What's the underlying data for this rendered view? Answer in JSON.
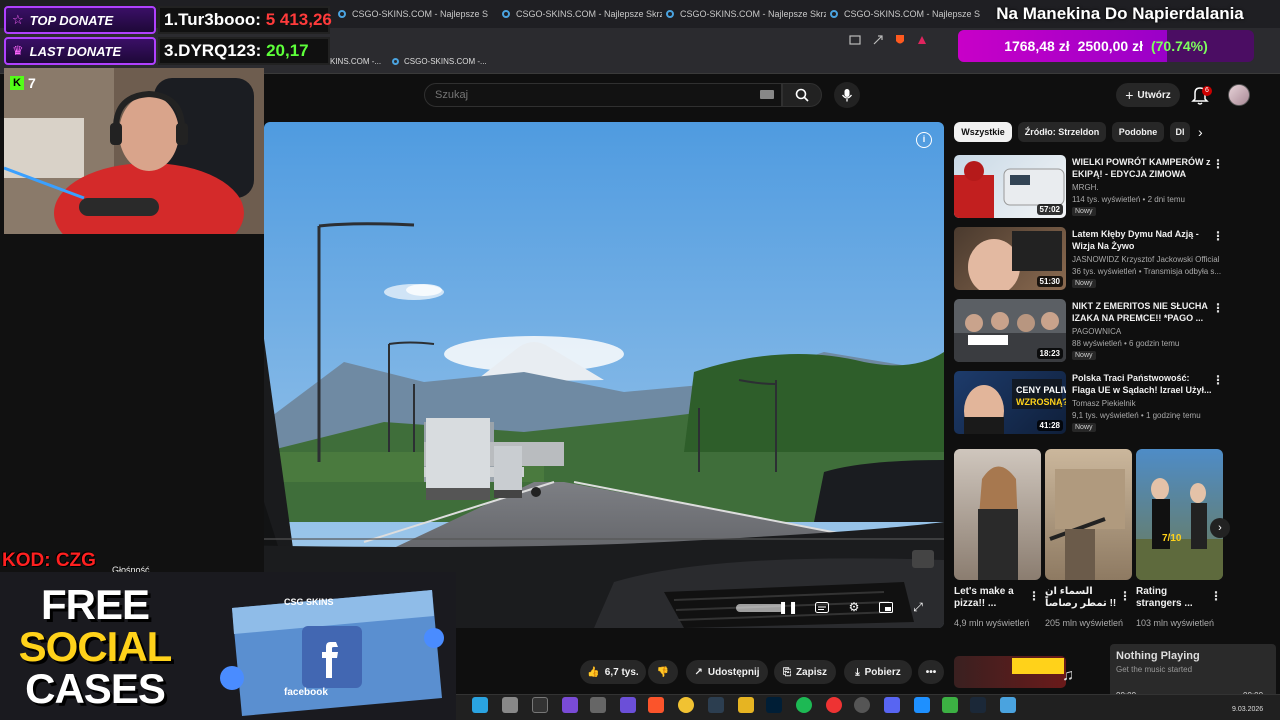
{
  "browser": {
    "tabs": [
      {
        "label": "CSGO-SKINS.COM - Najlepsze Skrzyn"
      },
      {
        "label": "CSGO-SKINS.COM - Najlepsze Skrzyn"
      },
      {
        "label": "CSGO-SKINS.COM - Najlepsze Skrzyn"
      },
      {
        "label": "CSGO-SKINS.COM - Najlepsze Skrzyn"
      }
    ],
    "bookmarks": [
      {
        "label": "KINS.COM -..."
      },
      {
        "label": "CSGO-SKINS.COM -..."
      }
    ]
  },
  "youtube": {
    "search_placeholder": "Szukaj",
    "create_label": "Utwórz",
    "notification_count": "6",
    "chips": [
      "Wszystkie",
      "Źródło: Strzeldon",
      "Podobne",
      "Dl"
    ],
    "actions": {
      "likes": "6,7 tys.",
      "share": "Udostępnij",
      "save": "Zapisz",
      "download": "Pobierz"
    },
    "volume_tooltip": "Głośność",
    "recommendations": [
      {
        "title": "WIELKI POWRÓT KAMPERÓW z EKIPĄ! - EDYCJA ZIMOWA",
        "channel": "MRGH.",
        "meta": "114 tys. wyświetleń • 2 dni temu",
        "duration": "57:02",
        "badge": "Nowy"
      },
      {
        "title": "Latem Kłęby Dymu Nad Azją - Wizja Na Żywo",
        "channel": "JASNOWIDZ Krzysztof Jackowski Official",
        "meta": "36 tys. wyświetleń • Transmisja odbyła s...",
        "duration": "51:30",
        "badge": "Nowy"
      },
      {
        "title": "NIKT Z EMERITOS NIE SŁUCHA IZAKA NA PREMCE!! *PAGO ...",
        "channel": "PAGOWNICA",
        "meta": "88 wyświetleń • 6 godzin temu",
        "duration": "18:23",
        "badge": "Nowy"
      },
      {
        "title": "Polska Traci Państwowość: Flaga UE w Sądach! Izrael Użył...",
        "channel": "Tomasz Piekielnik",
        "meta": "9,1 tys. wyświetleń • 1 godzinę temu",
        "duration": "41:28",
        "badge": "Nowy"
      }
    ],
    "shorts": [
      {
        "title": "Let's make a pizza!! ...",
        "views": "4,9 mln wyświetleń"
      },
      {
        "title": "السماء ان تمطر رصاصاً !!",
        "views": "205 mln wyświetleń"
      },
      {
        "title": "Rating strangers ...",
        "views": "103 mln wyświetleń"
      }
    ]
  },
  "stream": {
    "top_donate_label": "TOP DONATE",
    "top_donate_value_name": "1.Tur3booo:",
    "top_donate_value_amount": "5 413,26",
    "last_donate_label": "LAST DONATE",
    "last_donate_value_name": "3.DYRQ123:",
    "last_donate_value_amount": "20,17",
    "goal_title": "Na Manekina Do Napierdalania",
    "goal_current": "1768,48 zł",
    "goal_target": "2500,00 zł",
    "goal_percent": "(70.74%)",
    "goal_fraction": 0.7074,
    "viewer_count": "7",
    "promo_code": "KOD: CZG",
    "promo_lines": [
      "FREE",
      "SOCIAL",
      "CASES"
    ],
    "crate_brand": "CSG SKINS",
    "crate_label": "facebook"
  },
  "music_widget": {
    "title": "Nothing Playing",
    "subtitle": "Get the music started",
    "time_start": "00:00",
    "time_end": "00:00"
  },
  "taskbar": {
    "date": "9.03.2026"
  },
  "colors": {
    "accent_purple": "#b040ff",
    "goal_magenta": "#c800c8",
    "goal_pct_green": "#7dff5e",
    "promo_red": "#ff2020",
    "yt_red": "#cc0000"
  }
}
